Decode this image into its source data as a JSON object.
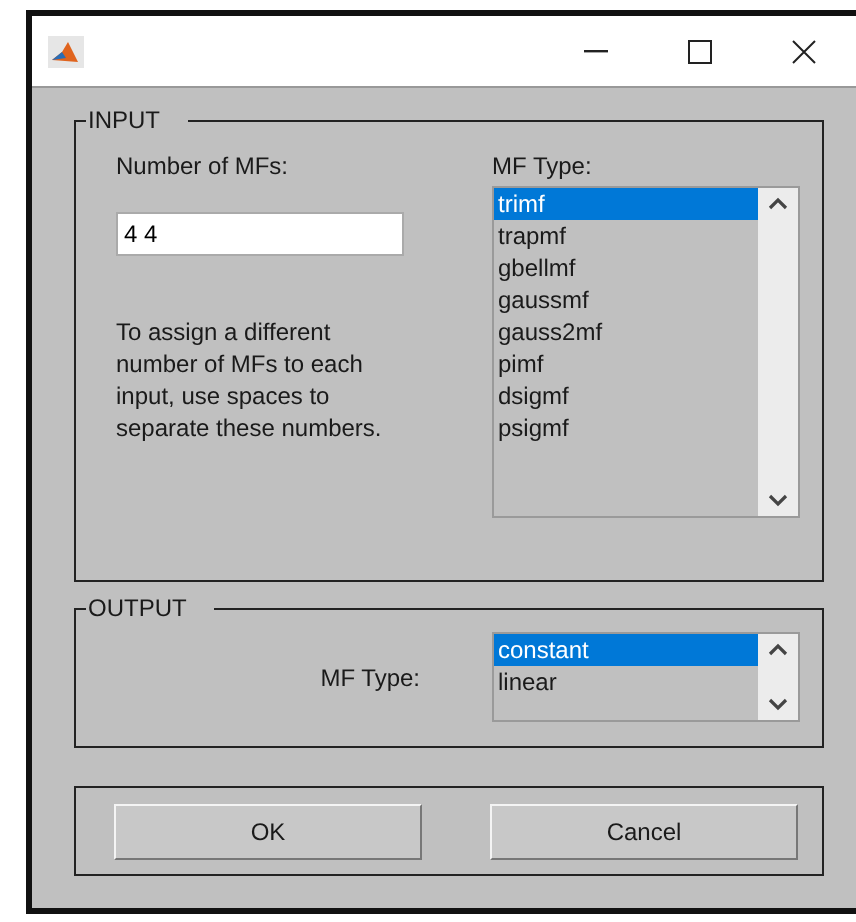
{
  "input": {
    "legend": "INPUT",
    "count_label": "Number of MFs:",
    "count_value": "4 4",
    "help": "To assign a different number of MFs to each input, use spaces to separate these numbers.",
    "type_label": "MF Type:",
    "types": [
      {
        "label": "trimf",
        "selected": true
      },
      {
        "label": "trapmf",
        "selected": false
      },
      {
        "label": "gbellmf",
        "selected": false
      },
      {
        "label": "gaussmf",
        "selected": false
      },
      {
        "label": "gauss2mf",
        "selected": false
      },
      {
        "label": "pimf",
        "selected": false
      },
      {
        "label": "dsigmf",
        "selected": false
      },
      {
        "label": "psigmf",
        "selected": false
      }
    ]
  },
  "output": {
    "legend": "OUTPUT",
    "type_label": "MF Type:",
    "types": [
      {
        "label": "constant",
        "selected": true
      },
      {
        "label": "linear",
        "selected": false
      }
    ]
  },
  "buttons": [
    "OK",
    "Cancel"
  ]
}
